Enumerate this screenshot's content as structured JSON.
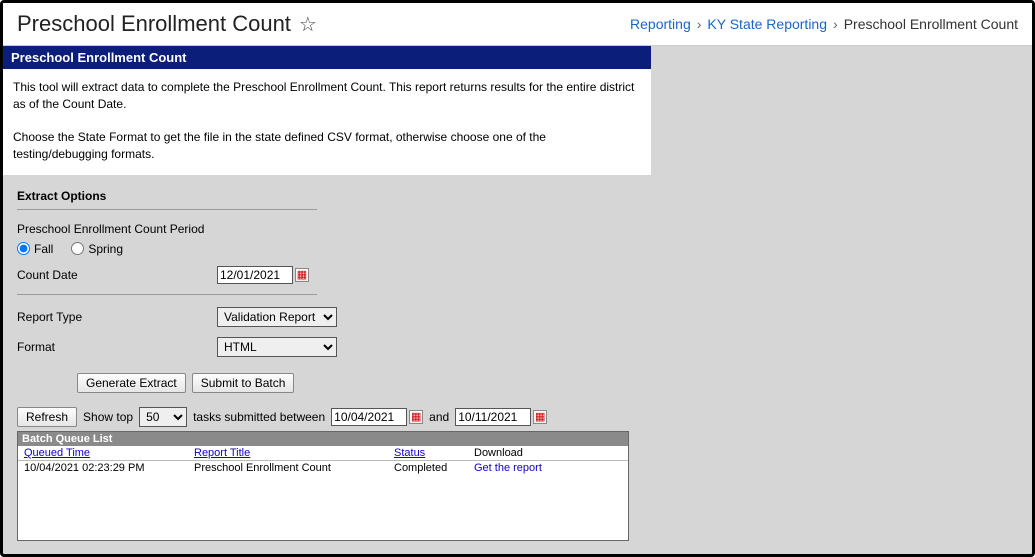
{
  "header": {
    "page_title": "Preschool Enrollment Count",
    "breadcrumb": {
      "a": "Reporting",
      "b": "KY State Reporting",
      "c": "Preschool Enrollment Count"
    }
  },
  "panel": {
    "title": "Preschool Enrollment Count",
    "desc1": "This tool will extract data to complete the Preschool Enrollment Count. This report returns results for the entire district as of the Count Date.",
    "desc2": "Choose the State Format to get the file in the state defined CSV format, otherwise choose one of the testing/debugging formats."
  },
  "form": {
    "extract_options_label": "Extract Options",
    "period_label": "Preschool Enrollment Count Period",
    "period_fall": "Fall",
    "period_spring": "Spring",
    "count_date_label": "Count Date",
    "count_date_value": "12/01/2021",
    "report_type_label": "Report Type",
    "report_type_value": "Validation Report",
    "format_label": "Format",
    "format_value": "HTML",
    "generate_label": "Generate Extract",
    "submit_label": "Submit to Batch"
  },
  "filter": {
    "refresh_label": "Refresh",
    "show_top_label": "Show top",
    "show_top_value": "50",
    "tasks_between_label": "tasks submitted between",
    "date_from": "10/04/2021",
    "and_label": "and",
    "date_to": "10/11/2021"
  },
  "batch": {
    "title": "Batch Queue List",
    "headers": {
      "queued_time": "Queued Time",
      "report_title": "Report Title",
      "status": "Status",
      "download": "Download"
    },
    "rows": [
      {
        "queued_time": "10/04/2021 02:23:29 PM",
        "report_title": "Preschool Enrollment Count",
        "status": "Completed",
        "download": "Get the report"
      }
    ]
  }
}
